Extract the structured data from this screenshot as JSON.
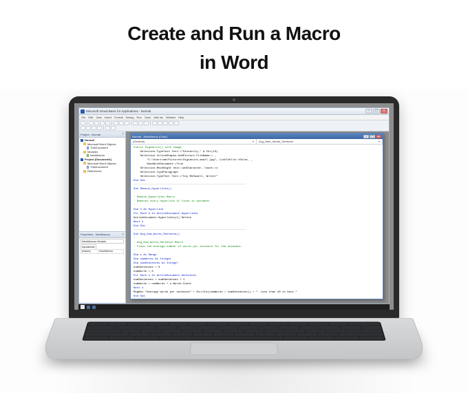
{
  "heading_line1": "Create and Run a Macro",
  "heading_line2": "in Word",
  "window": {
    "title": "Microsoft Visual Basic for Applications - Normal"
  },
  "menu": [
    "File",
    "Edit",
    "View",
    "Insert",
    "Format",
    "Debug",
    "Run",
    "Tools",
    "Add-Ins",
    "Window",
    "Help"
  ],
  "project_panel": {
    "title": "Project - Normal",
    "nodes": {
      "n0": "Normal",
      "n1": "Microsoft Word Objects",
      "n2": "ThisDocument",
      "n3": "Modules",
      "n4": "NewMacros",
      "n5": "Project (Document1)",
      "n6": "Microsoft Word Objects",
      "n7": "ThisDocument",
      "n8": "References"
    }
  },
  "props_panel": {
    "title": "Properties - NewMacros",
    "object": "NewMacros Module",
    "tab": "Alphabetic",
    "rows": [
      {
        "k": "(Name)",
        "v": "NewMacros"
      }
    ]
  },
  "code_window": {
    "title": "Normal - NewMacros (Code)",
    "left_dd": "(General)",
    "right_dd": "Avg_Num_Words_Sentence"
  },
  "code": {
    "l01": "Public Signature() with image.",
    "l02": "    Selection.TypeText Text:=\"Sincerely,\" & Chr(13)",
    "l03": "    Selection.InlineShapes.AddPicture FileName:= _",
    "l04": "        \"C:\\Users\\mm\\Pictures\\Signature_small.jpg\", LinkToFile:=False, _",
    "l05": "        SaveWithDocument:=True",
    "l06": "    Selection.MoveRight Unit:=wdCharacter, Count:=1",
    "l07": "    Selection.TypeParagraph",
    "l08": "    Selection.TypeText Text:=\"Coy McDowell, Writer\"",
    "l09": "End Sub",
    "l10": "Sub Remove_Hyperlinks()",
    "l11": "'",
    "l12": "' Remove_Hyperlinks Macro",
    "l13": "' Removes every Hyperlink it finds in document.",
    "l14": "'",
    "l15": "Dim h As Hyperlink",
    "l16": "For Each h In ActiveDocument.Hyperlinks",
    "l17": "ActiveDocument.Hyperlinks(1).Delete",
    "l18": "Next h",
    "l19": "End Sub",
    "l20": "Sub Avg_Num_Words_Sentence()",
    "l21": "'",
    "l22": "' Avg_Num_Words_Sentence Macro",
    "l23": "' Finds the average number of words per sentence for the document.",
    "l24": "'",
    "l25": "Dim s As Range",
    "l26": "Dim numWords As Integer",
    "l27": "Dim numSentences As Integer",
    "l28": "numSentences = 0",
    "l29": "numWords = 0",
    "l30": "For Each s In ActiveDocument.Sentences",
    "l31": "numSentences = numSentences + 1",
    "l32": "numWords = numWords + s.Words.Count",
    "l33": "Next s",
    "l34": "MsgBox \"Average words per sentence\" + Str(Int(numWords / numSentences)) + \". Less than 20 is best.\"",
    "l35": "End Sub"
  }
}
